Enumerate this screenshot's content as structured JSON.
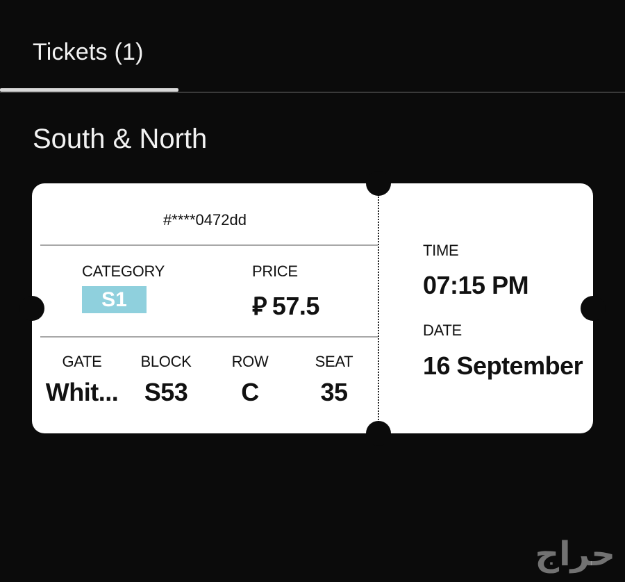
{
  "tabs": [
    {
      "label": "Tickets (1)",
      "active": true
    }
  ],
  "section_title": "South & North",
  "ticket": {
    "id": "#****0472dd",
    "category_label": "CATEGORY",
    "category_value": "S1",
    "category_color": "#8fd0dd",
    "price_label": "PRICE",
    "price_currency": "⃁",
    "price_value": "57.5",
    "gate_label": "GATE",
    "gate_value": "Whit...",
    "block_label": "BLOCK",
    "block_value": "S53",
    "row_label": "ROW",
    "row_value": "C",
    "seat_label": "SEAT",
    "seat_value": "35",
    "time_label": "TIME",
    "time_value": "07:15 PM",
    "date_label": "DATE",
    "date_value": "16 September"
  },
  "watermark": "حراج"
}
